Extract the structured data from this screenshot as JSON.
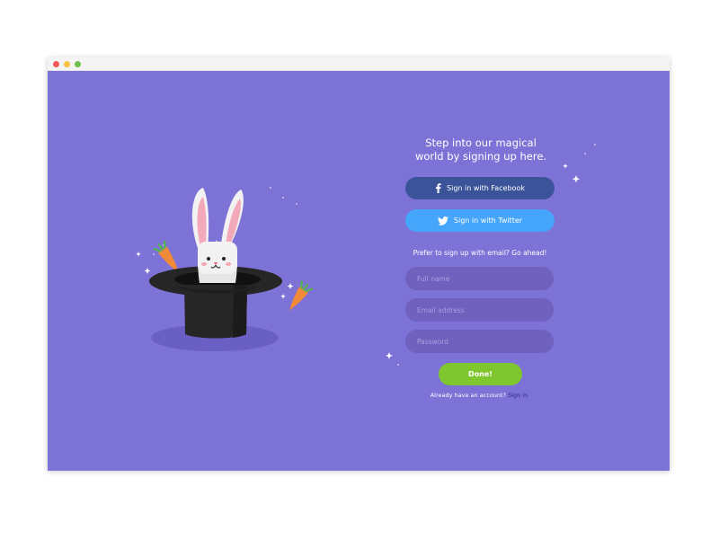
{
  "window": {
    "controls": [
      "close",
      "minimize",
      "maximize"
    ]
  },
  "illustration": {
    "icons": [
      "rabbit-icon",
      "top-hat-icon",
      "carrot-icon",
      "sparkle-icon"
    ]
  },
  "signup": {
    "headline_line1": "Step into our magical",
    "headline_line2": "world by signing up here.",
    "facebook_label": "Sign in with Facebook",
    "twitter_label": "Sign in with Twitter",
    "email_prompt": "Prefer to sign up with email? Go ahead!",
    "fields": {
      "full_name_placeholder": "Full name",
      "email_placeholder": "Email address",
      "password_placeholder": "Password"
    },
    "submit_label": "Done!",
    "already_text": "Already have an account?",
    "signin_link": "Sign in"
  },
  "colors": {
    "background": "#7d72d6",
    "facebook": "#3b5499",
    "twitter": "#45a5fb",
    "field": "#6f61bd",
    "submit": "#7fc62f",
    "link": "#2f2a7c"
  }
}
